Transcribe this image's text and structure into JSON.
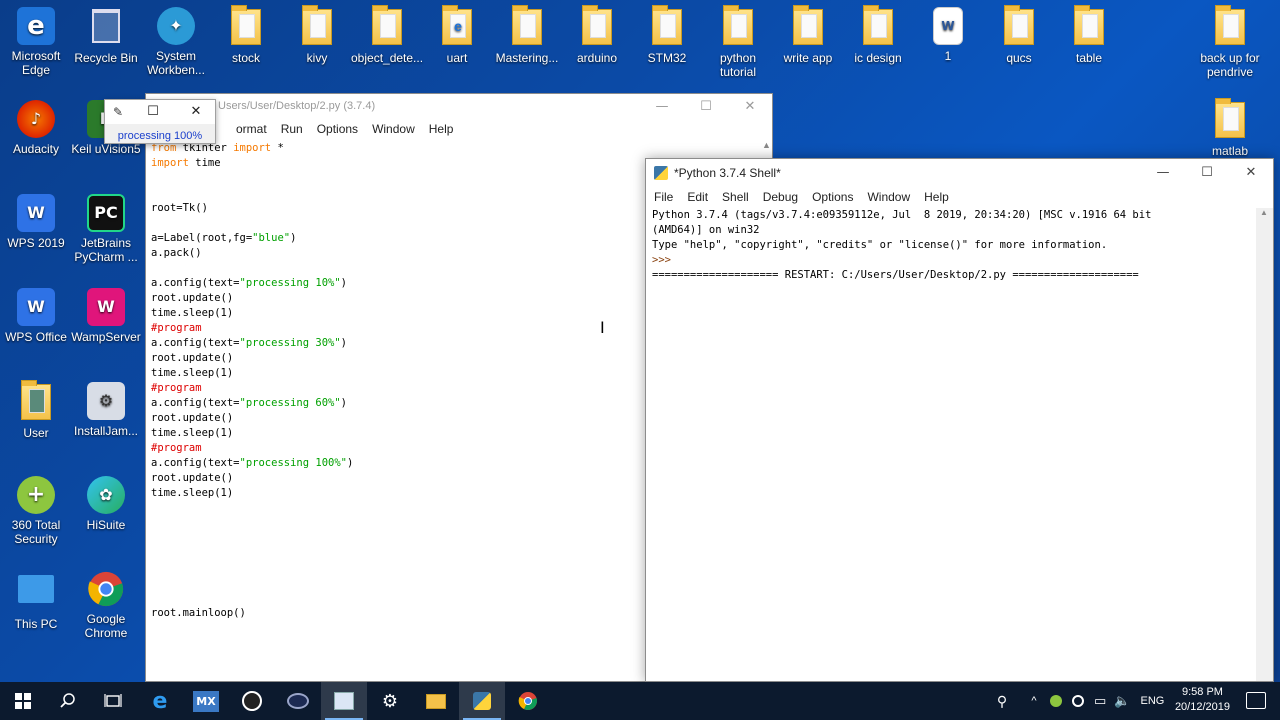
{
  "desktop": {
    "icons": [
      {
        "label": "Microsoft Edge",
        "icon": "edge-icon"
      },
      {
        "label": "Recycle Bin",
        "icon": "recycle-bin-icon"
      },
      {
        "label": "System Workben...",
        "icon": "system-workbench-icon"
      },
      {
        "label": "stock",
        "icon": "document-icon"
      },
      {
        "label": "kivy",
        "icon": "document-icon"
      },
      {
        "label": "object_dete...",
        "icon": "folder-icon"
      },
      {
        "label": "uart",
        "icon": "edge-file-icon"
      },
      {
        "label": "Mastering...",
        "icon": "folder-icon"
      },
      {
        "label": "arduino",
        "icon": "folder-icon"
      },
      {
        "label": "STM32",
        "icon": "folder-icon"
      },
      {
        "label": "python tutorial",
        "icon": "folder-icon"
      },
      {
        "label": "write app",
        "icon": "folder-icon"
      },
      {
        "label": "ic design",
        "icon": "folder-icon"
      },
      {
        "label": "1",
        "icon": "word-document-icon"
      },
      {
        "label": "qucs",
        "icon": "folder-icon"
      },
      {
        "label": "table",
        "icon": "folder-icon"
      },
      {
        "label": "back up for pendrive",
        "icon": "folder-icon"
      },
      {
        "label": "Audacity",
        "icon": "audacity-icon"
      },
      {
        "label": "Keil uVision5",
        "icon": "keil-icon"
      },
      {
        "label": "matlab",
        "icon": "folder-icon"
      },
      {
        "label": "WPS 2019",
        "icon": "wps-icon"
      },
      {
        "label": "JetBrains PyCharm ...",
        "icon": "pycharm-icon"
      },
      {
        "label": "WPS Office",
        "icon": "wps-office-icon"
      },
      {
        "label": "WampServer",
        "icon": "wampserver-icon"
      },
      {
        "label": "User",
        "icon": "user-folder-icon"
      },
      {
        "label": "InstallJam...",
        "icon": "installjammer-icon"
      },
      {
        "label": "360 Total Security",
        "icon": "360-security-icon"
      },
      {
        "label": "HiSuite",
        "icon": "hisuite-icon"
      },
      {
        "label": "This PC",
        "icon": "this-pc-icon"
      },
      {
        "label": "Google Chrome",
        "icon": "chrome-icon"
      }
    ]
  },
  "editor": {
    "title": "Users/User/Desktop/2.py (3.7.4)",
    "menu": [
      "ormat",
      "Run",
      "Options",
      "Window",
      "Help"
    ],
    "code_lines": [
      [
        {
          "t": "from",
          "c": "kw"
        },
        {
          "t": " tkinter ",
          "c": ""
        },
        {
          "t": "import",
          "c": "kw"
        },
        {
          "t": " *",
          "c": ""
        }
      ],
      [
        {
          "t": "import",
          "c": "kw"
        },
        {
          "t": " time",
          "c": ""
        }
      ],
      [],
      [],
      [
        {
          "t": "root=Tk()",
          "c": ""
        }
      ],
      [],
      [
        {
          "t": "a=Label(root,fg=",
          "c": ""
        },
        {
          "t": "\"blue\"",
          "c": "str"
        },
        {
          "t": ")",
          "c": ""
        }
      ],
      [
        {
          "t": "a.pack()",
          "c": ""
        }
      ],
      [],
      [
        {
          "t": "a.config(text=",
          "c": ""
        },
        {
          "t": "\"processing 10%\"",
          "c": "str"
        },
        {
          "t": ")",
          "c": ""
        }
      ],
      [
        {
          "t": "root.update()",
          "c": ""
        }
      ],
      [
        {
          "t": "time.sleep(1)",
          "c": ""
        }
      ],
      [
        {
          "t": "#program",
          "c": "cmt"
        }
      ],
      [
        {
          "t": "a.config(text=",
          "c": ""
        },
        {
          "t": "\"processing 30%\"",
          "c": "str"
        },
        {
          "t": ")",
          "c": ""
        }
      ],
      [
        {
          "t": "root.update()",
          "c": ""
        }
      ],
      [
        {
          "t": "time.sleep(1)",
          "c": ""
        }
      ],
      [
        {
          "t": "#program",
          "c": "cmt"
        }
      ],
      [
        {
          "t": "a.config(text=",
          "c": ""
        },
        {
          "t": "\"processing 60%\"",
          "c": "str"
        },
        {
          "t": ")",
          "c": ""
        }
      ],
      [
        {
          "t": "root.update()",
          "c": ""
        }
      ],
      [
        {
          "t": "time.sleep(1)",
          "c": ""
        }
      ],
      [
        {
          "t": "#program",
          "c": "cmt"
        }
      ],
      [
        {
          "t": "a.config(text=",
          "c": ""
        },
        {
          "t": "\"processing 100%\"",
          "c": "str"
        },
        {
          "t": ")",
          "c": ""
        }
      ],
      [
        {
          "t": "root.update()",
          "c": ""
        }
      ],
      [
        {
          "t": "time.sleep(1)",
          "c": ""
        }
      ],
      [],
      [],
      [],
      [],
      [],
      [],
      [],
      [
        {
          "t": "root.mainloop()",
          "c": ""
        }
      ]
    ]
  },
  "tk_window": {
    "label": "processing 100%",
    "label_color": "#1a3fcc"
  },
  "shell": {
    "title": "*Python 3.7.4 Shell*",
    "menu": [
      "File",
      "Edit",
      "Shell",
      "Debug",
      "Options",
      "Window",
      "Help"
    ],
    "lines": [
      {
        "t": "Python 3.7.4 (tags/v3.7.4:e09359112e, Jul  8 2019, 20:34:20) [MSC v.1916 64 bit",
        "c": ""
      },
      {
        "t": "(AMD64)] on win32",
        "c": ""
      },
      {
        "t": "Type \"help\", \"copyright\", \"credits\" or \"license()\" for more information.",
        "c": ""
      },
      {
        "t": ">>>",
        "c": "prompt"
      },
      {
        "t": "==================== RESTART: C:/Users/User/Desktop/2.py ====================",
        "c": "restart"
      }
    ]
  },
  "window_controls": {
    "minimize": "—",
    "maximize": "☐",
    "close": "✕"
  },
  "taskbar": {
    "items": [
      "start-button",
      "search-button",
      "task-view-button",
      "edge-taskbar",
      "mobaxterm-taskbar",
      "app-taskbar",
      "app2-taskbar",
      "idle-taskbar",
      "app3-taskbar",
      "file-explorer-taskbar",
      "python-taskbar",
      "chrome-taskbar"
    ],
    "mx_label": "MX",
    "language": "ENG",
    "time": "9:58 PM",
    "date": "20/12/2019"
  },
  "colors": {
    "keyword": "#f57900",
    "string": "#00a000",
    "comment": "#dd0000",
    "prompt": "#8b4513"
  }
}
